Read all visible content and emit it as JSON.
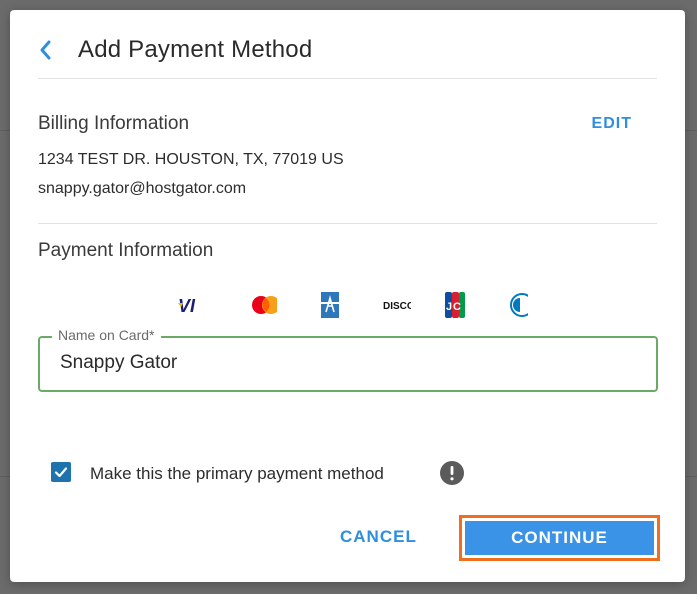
{
  "dialog": {
    "title": "Add Payment Method"
  },
  "billing": {
    "title": "Billing Information",
    "edit_label": "EDIT",
    "address": "1234 TEST DR. HOUSTON, TX, 77019 US",
    "email": "snappy.gator@hostgator.com"
  },
  "payment": {
    "title": "Payment Information",
    "card_icons": [
      "visa-icon",
      "mastercard-icon",
      "amex-icon",
      "discover-icon",
      "jcb-icon",
      "diners-icon"
    ],
    "name_label": "Name on Card*",
    "name_value": "Snappy Gator"
  },
  "primary": {
    "label": "Make this the primary payment method",
    "checked": true
  },
  "actions": {
    "cancel_label": "CANCEL",
    "continue_label": "CONTINUE"
  },
  "colors": {
    "accent": "#2e8fe0",
    "checkbox": "#1f73ad",
    "field_border": "#6aaa64",
    "highlight": "#ef6f1f"
  }
}
